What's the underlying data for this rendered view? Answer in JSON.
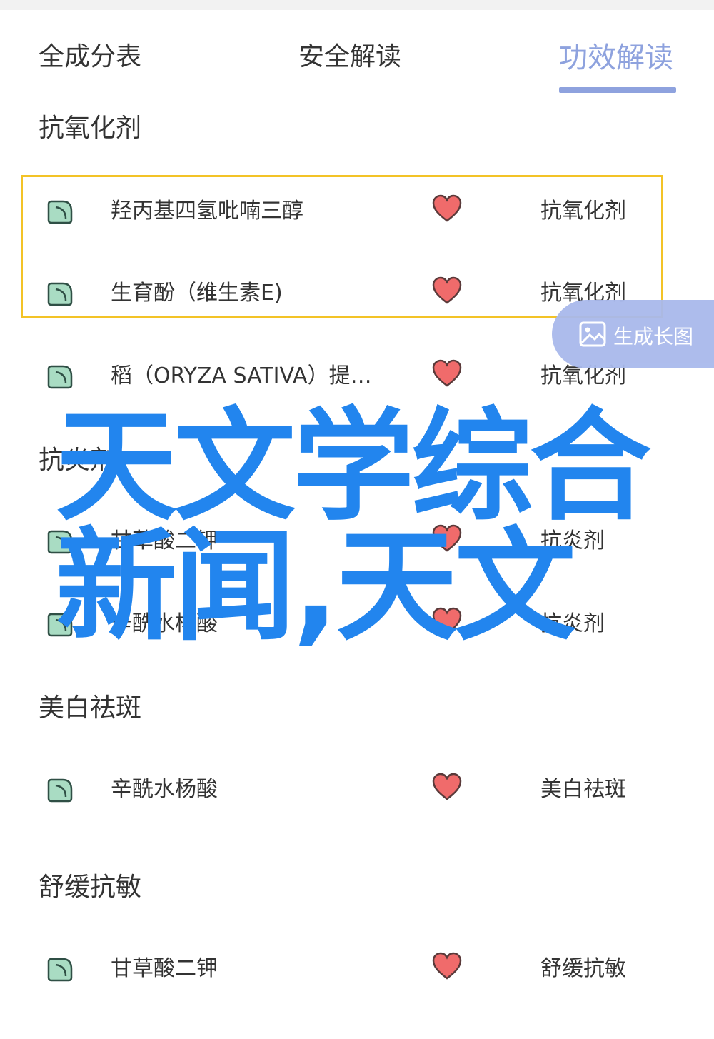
{
  "tabs": [
    {
      "label": "全成分表"
    },
    {
      "label": "安全解读"
    },
    {
      "label": "功效解读",
      "active": true
    }
  ],
  "colors": {
    "accent": "#8ea2de",
    "highlight": "#f3c326",
    "heart": "#f06b6b",
    "leaf": "#a9dcc3",
    "overlay_text": "#2285ee"
  },
  "icons": {
    "leaf": "leaf-icon",
    "heart": "heart-icon",
    "chart": "image-icon"
  },
  "sections": [
    {
      "title": "抗氧化剂",
      "items": [
        {
          "name": "羟丙基四氢吡喃三醇",
          "tag": "抗氧化剂"
        },
        {
          "name": "生育酚（维生素E)",
          "tag": "抗氧化剂"
        },
        {
          "name": "稻（ORYZA SATIVA）提…",
          "tag": "抗氧化剂"
        }
      ]
    },
    {
      "title": "抗炎剂",
      "items": [
        {
          "name": "甘草酸二钾",
          "tag": "抗炎剂"
        },
        {
          "name": "辛酰水杨酸",
          "tag": "抗炎剂"
        }
      ]
    },
    {
      "title": "美白祛斑",
      "items": [
        {
          "name": "辛酰水杨酸",
          "tag": "美白祛斑"
        }
      ]
    },
    {
      "title": "舒缓抗敏",
      "items": [
        {
          "name": "甘草酸二钾",
          "tag": "舒缓抗敏"
        }
      ]
    }
  ],
  "float_button": {
    "label": "生成长图"
  },
  "overlay": {
    "line1": "天文学综合",
    "line2": "新闻,天文"
  }
}
